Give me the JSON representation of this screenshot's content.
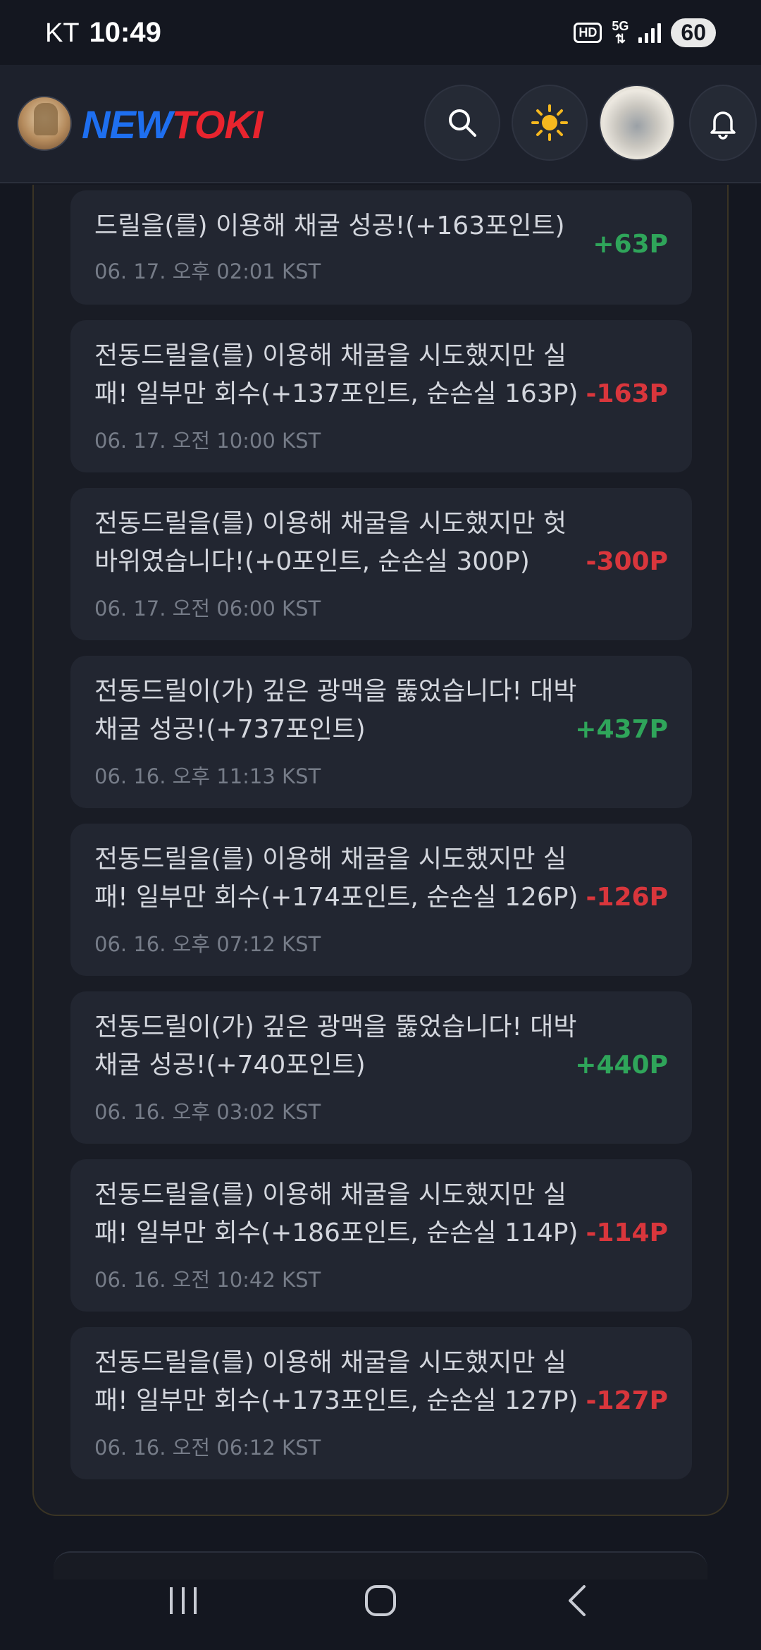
{
  "status_bar": {
    "carrier": "KT",
    "time": "10:49",
    "hd_label": "HD",
    "network_label": "5G",
    "battery": "60"
  },
  "header": {
    "logo_part1": "NEW",
    "logo_part2": "TOKI"
  },
  "entries": [
    {
      "message": "드릴을(를) 이용해 채굴 성공!(+163포인트)",
      "date": "06. 17. 오후 02:01 KST",
      "points": "+63P",
      "type": "gain"
    },
    {
      "message": "전동드릴을(를) 이용해 채굴을 시도했지만 실패! 일부만 회수(+137포인트, 순손실 163P)",
      "date": "06. 17. 오전 10:00 KST",
      "points": "-163P",
      "type": "loss"
    },
    {
      "message": "전동드릴을(를) 이용해 채굴을 시도했지만 헛바위였습니다!(+0포인트, 순손실 300P)",
      "date": "06. 17. 오전 06:00 KST",
      "points": "-300P",
      "type": "loss"
    },
    {
      "message": "전동드릴이(가) 깊은 광맥을 뚫었습니다! 대박 채굴 성공!(+737포인트)",
      "date": "06. 16. 오후 11:13 KST",
      "points": "+437P",
      "type": "gain"
    },
    {
      "message": "전동드릴을(를) 이용해 채굴을 시도했지만 실패! 일부만 회수(+174포인트, 순손실 126P)",
      "date": "06. 16. 오후 07:12 KST",
      "points": "-126P",
      "type": "loss"
    },
    {
      "message": "전동드릴이(가) 깊은 광맥을 뚫었습니다! 대박 채굴 성공!(+740포인트)",
      "date": "06. 16. 오후 03:02 KST",
      "points": "+440P",
      "type": "gain"
    },
    {
      "message": "전동드릴을(를) 이용해 채굴을 시도했지만 실패! 일부만 회수(+186포인트, 순손실 114P)",
      "date": "06. 16. 오전 10:42 KST",
      "points": "-114P",
      "type": "loss"
    },
    {
      "message": "전동드릴을(를) 이용해 채굴을 시도했지만 실패! 일부만 회수(+173포인트, 순손실 127P)",
      "date": "06. 16. 오전 06:12 KST",
      "points": "-127P",
      "type": "loss"
    }
  ],
  "colors": {
    "gain": "#2fa55a",
    "loss": "#d9363c",
    "accent_blue": "#1e6ff0",
    "accent_red": "#e8242e"
  },
  "icons": {
    "search": "search-icon",
    "theme": "sun-icon",
    "notifications": "bell-icon",
    "nav_recents": "recents-icon",
    "nav_home": "home-icon",
    "nav_back": "back-icon"
  }
}
